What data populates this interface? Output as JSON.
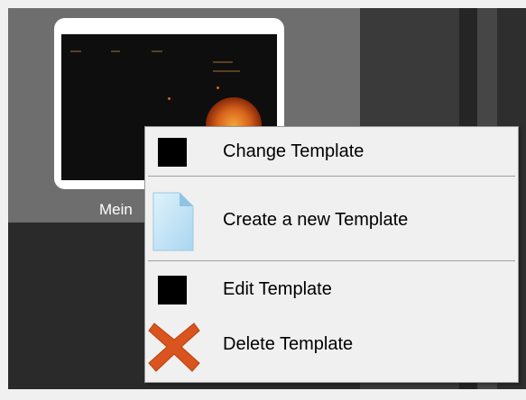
{
  "tile": {
    "label": "Mein"
  },
  "context_menu": {
    "items": [
      {
        "label": "Change Template",
        "icon": "black-square-icon"
      },
      {
        "label": "Create a new Template",
        "icon": "new-document-icon"
      },
      {
        "label": "Edit Template",
        "icon": "black-square-icon"
      },
      {
        "label": "Delete Template",
        "icon": "red-x-delete-icon"
      }
    ]
  },
  "colors": {
    "menu_background": "#f0f0f0",
    "delete_icon": "#d9541e",
    "document_icon": "#bfe3f6"
  }
}
